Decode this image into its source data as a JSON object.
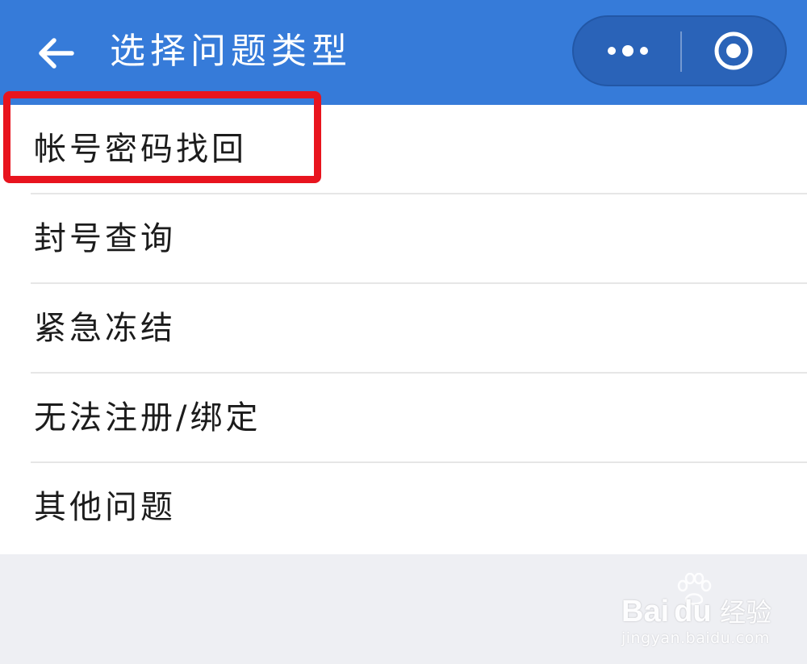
{
  "header": {
    "title": "选择问题类型",
    "back_icon": "arrow-left-icon",
    "capsule": {
      "more_icon": "more-dots-icon",
      "close_icon": "target-circle-icon"
    },
    "bg_color": "#367bd9"
  },
  "items": [
    {
      "label": "帐号密码找回",
      "highlighted": true
    },
    {
      "label": "封号查询"
    },
    {
      "label": "紧急冻结"
    },
    {
      "label": "无法注册/绑定"
    },
    {
      "label": "其他问题"
    }
  ],
  "highlight_color": "#e8141e",
  "watermark": {
    "brand": "Bai",
    "brand_suffix": "du",
    "product": "经验",
    "url": "jingyan.baidu.com"
  }
}
